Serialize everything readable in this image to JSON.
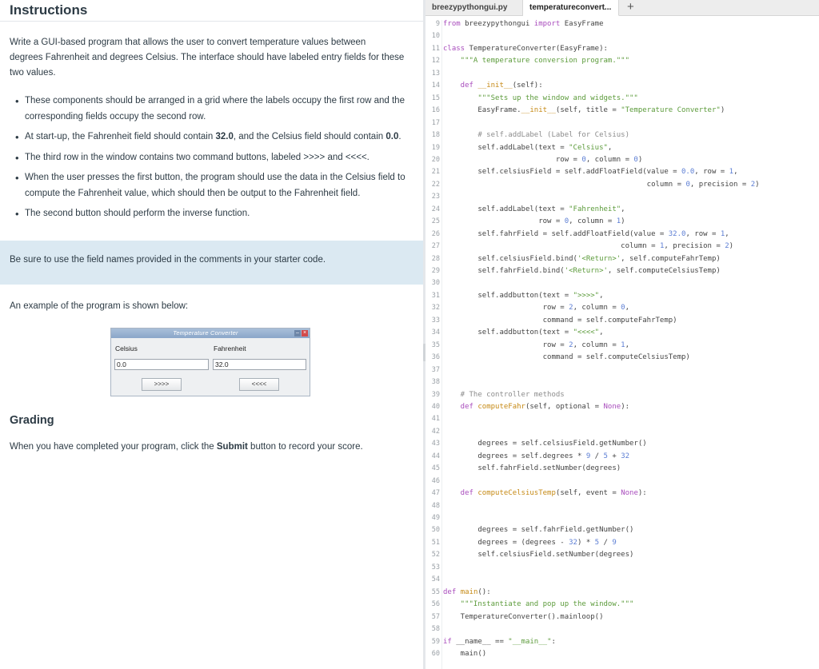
{
  "instructions": {
    "title": "Instructions",
    "intro": [
      "Write a GUI-based program that allows the user to convert temperature values between",
      "degrees Fahrenheit and degrees Celsius. The interface should have labeled entry fields for these",
      "two values."
    ],
    "bullets": [
      [
        {
          "t": "These components should be arranged in a grid where the labels occupy the first row and the corresponding fields occupy the second row."
        }
      ],
      [
        {
          "t": "At start-up, the Fahrenheit field should contain "
        },
        {
          "t": "32.0",
          "b": true
        },
        {
          "t": ", and the Celsius field should contain "
        },
        {
          "t": "0.0",
          "b": true
        },
        {
          "t": "."
        }
      ],
      [
        {
          "t": "The third row in the window contains two command buttons, labeled >>>> and <<<<."
        }
      ],
      [
        {
          "t": "When the user presses the first button, the program should use the data in the Celsius field to compute the Fahrenheit value, which should then be output to the Fahrenheit field."
        }
      ],
      [
        {
          "t": "The second button should perform the inverse function."
        }
      ]
    ],
    "note": "Be sure to use the field names provided in the comments in your starter code.",
    "example_text": "An example of the program is shown below:",
    "grading_title": "Grading",
    "grading_text": [
      {
        "t": "When you have completed your program, click the "
      },
      {
        "t": "Submit",
        "b": true
      },
      {
        "t": " button to record your score."
      }
    ]
  },
  "example_window": {
    "title": "Temperature Converter",
    "celsius_label": "Celsius",
    "fahrenheit_label": "Fahrenheit",
    "celsius_value": "0.0",
    "fahrenheit_value": "32.0",
    "btn_to_fahr": ">>>>",
    "btn_to_cels": "<<<<"
  },
  "editor": {
    "tabs": [
      {
        "label": "breezypythongui.py",
        "active": false
      },
      {
        "label": "temperatureconvert...",
        "active": true
      }
    ],
    "add_tab": "+",
    "lines": [
      {
        "n": "9",
        "s": [
          [
            "from ",
            "k"
          ],
          [
            "breezypythongui ",
            "n"
          ],
          [
            "import ",
            "k"
          ],
          [
            "EasyFrame",
            "n"
          ]
        ]
      },
      {
        "n": "10",
        "s": []
      },
      {
        "n": "11",
        "s": [
          [
            "class ",
            "k"
          ],
          [
            "TemperatureConverter",
            "n"
          ],
          [
            "(EasyFrame):",
            "n"
          ]
        ]
      },
      {
        "n": "12",
        "s": [
          [
            "    \"\"\"A temperature conversion program.\"\"\"",
            "st"
          ]
        ]
      },
      {
        "n": "13",
        "s": []
      },
      {
        "n": "14",
        "s": [
          [
            "    def ",
            "k"
          ],
          [
            "__init__",
            "fn"
          ],
          [
            "(self):",
            "n"
          ]
        ]
      },
      {
        "n": "15",
        "s": [
          [
            "        \"\"\"Sets up the window and widgets.\"\"\"",
            "st"
          ]
        ]
      },
      {
        "n": "16",
        "s": [
          [
            "        EasyFrame.",
            "n"
          ],
          [
            "__init__",
            "fn"
          ],
          [
            "(self, title = ",
            "n"
          ],
          [
            "\"Temperature Converter\"",
            "st"
          ],
          [
            ")",
            "n"
          ]
        ]
      },
      {
        "n": "17",
        "s": []
      },
      {
        "n": "18",
        "s": [
          [
            "        # self.addLabel (Label for Celsius)",
            "cm"
          ]
        ]
      },
      {
        "n": "19",
        "s": [
          [
            "        self.addLabel(text = ",
            "n"
          ],
          [
            "\"Celsius\"",
            "st"
          ],
          [
            ",",
            "n"
          ]
        ]
      },
      {
        "n": "20",
        "s": [
          [
            "                          row = ",
            "n"
          ],
          [
            "0",
            "num"
          ],
          [
            ", column = ",
            "n"
          ],
          [
            "0",
            "num"
          ],
          [
            ")",
            "n"
          ]
        ]
      },
      {
        "n": "21",
        "s": [
          [
            "        self.celsiusField = self.addFloatField(value = ",
            "n"
          ],
          [
            "0.0",
            "num"
          ],
          [
            ", row = ",
            "n"
          ],
          [
            "1",
            "num"
          ],
          [
            ",",
            "n"
          ]
        ]
      },
      {
        "n": "22",
        "s": [
          [
            "                                               column = ",
            "n"
          ],
          [
            "0",
            "num"
          ],
          [
            ", precision = ",
            "n"
          ],
          [
            "2",
            "num"
          ],
          [
            ")",
            "n"
          ]
        ]
      },
      {
        "n": "23",
        "s": []
      },
      {
        "n": "24",
        "s": [
          [
            "        self.addLabel(text = ",
            "n"
          ],
          [
            "\"Fahrenheit\"",
            "st"
          ],
          [
            ",",
            "n"
          ]
        ]
      },
      {
        "n": "25",
        "s": [
          [
            "                      row = ",
            "n"
          ],
          [
            "0",
            "num"
          ],
          [
            ", column = ",
            "n"
          ],
          [
            "1",
            "num"
          ],
          [
            ")",
            "n"
          ]
        ]
      },
      {
        "n": "26",
        "s": [
          [
            "        self.fahrField = self.addFloatField(value = ",
            "n"
          ],
          [
            "32.0",
            "num"
          ],
          [
            ", row = ",
            "n"
          ],
          [
            "1",
            "num"
          ],
          [
            ",",
            "n"
          ]
        ]
      },
      {
        "n": "27",
        "s": [
          [
            "                                         column = ",
            "n"
          ],
          [
            "1",
            "num"
          ],
          [
            ", precision = ",
            "n"
          ],
          [
            "2",
            "num"
          ],
          [
            ")",
            "n"
          ]
        ]
      },
      {
        "n": "28",
        "s": [
          [
            "        self.celsiusField.bind(",
            "n"
          ],
          [
            "'<Return>'",
            "st"
          ],
          [
            ", self.computeFahrTemp)",
            "n"
          ]
        ]
      },
      {
        "n": "29",
        "s": [
          [
            "        self.fahrField.bind(",
            "n"
          ],
          [
            "'<Return>'",
            "st"
          ],
          [
            ", self.computeCelsiusTemp)",
            "n"
          ]
        ]
      },
      {
        "n": "30",
        "s": []
      },
      {
        "n": "31",
        "s": [
          [
            "        self.addbutton(text = ",
            "n"
          ],
          [
            "\">>>>\"",
            "st"
          ],
          [
            ",",
            "n"
          ]
        ]
      },
      {
        "n": "32",
        "s": [
          [
            "                       row = ",
            "n"
          ],
          [
            "2",
            "num"
          ],
          [
            ", column = ",
            "n"
          ],
          [
            "0",
            "num"
          ],
          [
            ",",
            "n"
          ]
        ]
      },
      {
        "n": "33",
        "s": [
          [
            "                       command = self.computeFahrTemp)",
            "n"
          ]
        ]
      },
      {
        "n": "34",
        "s": [
          [
            "        self.addbutton(text = ",
            "n"
          ],
          [
            "\"<<<<\"",
            "st"
          ],
          [
            ",",
            "n"
          ]
        ]
      },
      {
        "n": "35",
        "s": [
          [
            "                       row = ",
            "n"
          ],
          [
            "2",
            "num"
          ],
          [
            ", column = ",
            "n"
          ],
          [
            "1",
            "num"
          ],
          [
            ",",
            "n"
          ]
        ]
      },
      {
        "n": "36",
        "s": [
          [
            "                       command = self.computeCelsiusTemp)",
            "n"
          ]
        ]
      },
      {
        "n": "37",
        "s": []
      },
      {
        "n": "38",
        "s": []
      },
      {
        "n": "39",
        "s": [
          [
            "    # The controller methods",
            "cm"
          ]
        ]
      },
      {
        "n": "40",
        "s": [
          [
            "    def ",
            "k"
          ],
          [
            "computeFahr",
            "fn"
          ],
          [
            "(self, optional = ",
            "n"
          ],
          [
            "None",
            "k"
          ],
          [
            "):",
            "n"
          ]
        ]
      },
      {
        "n": "41",
        "s": []
      },
      {
        "n": "42",
        "s": []
      },
      {
        "n": "43",
        "s": [
          [
            "        degrees = self.celsiusField.getNumber()",
            "n"
          ]
        ]
      },
      {
        "n": "44",
        "s": [
          [
            "        degrees = self.degrees * ",
            "n"
          ],
          [
            "9",
            "num"
          ],
          [
            " / ",
            "n"
          ],
          [
            "5",
            "num"
          ],
          [
            " + ",
            "n"
          ],
          [
            "32",
            "num"
          ]
        ]
      },
      {
        "n": "45",
        "s": [
          [
            "        self.fahrField.setNumber(degrees)",
            "n"
          ]
        ]
      },
      {
        "n": "46",
        "s": []
      },
      {
        "n": "47",
        "s": [
          [
            "    def ",
            "k"
          ],
          [
            "computeCelsiusTemp",
            "fn"
          ],
          [
            "(self, event = ",
            "n"
          ],
          [
            "None",
            "k"
          ],
          [
            "):",
            "n"
          ]
        ]
      },
      {
        "n": "48",
        "s": []
      },
      {
        "n": "49",
        "s": []
      },
      {
        "n": "50",
        "s": [
          [
            "        degrees = self.fahrField.getNumber()",
            "n"
          ]
        ]
      },
      {
        "n": "51",
        "s": [
          [
            "        degrees = (degrees - ",
            "n"
          ],
          [
            "32",
            "num"
          ],
          [
            ") * ",
            "n"
          ],
          [
            "5",
            "num"
          ],
          [
            " / ",
            "n"
          ],
          [
            "9",
            "num"
          ]
        ]
      },
      {
        "n": "52",
        "s": [
          [
            "        self.celsiusField.setNumber(degrees)",
            "n"
          ]
        ]
      },
      {
        "n": "53",
        "s": []
      },
      {
        "n": "54",
        "s": []
      },
      {
        "n": "55",
        "s": [
          [
            "def ",
            "k"
          ],
          [
            "main",
            "fn"
          ],
          [
            "():",
            "n"
          ]
        ]
      },
      {
        "n": "56",
        "s": [
          [
            "    \"\"\"Instantiate and pop up the window.\"\"\"",
            "st"
          ]
        ]
      },
      {
        "n": "57",
        "s": [
          [
            "    TemperatureConverter().mainloop()",
            "n"
          ]
        ]
      },
      {
        "n": "58",
        "s": []
      },
      {
        "n": "59",
        "s": [
          [
            "if ",
            "k"
          ],
          [
            "__name__ == ",
            "n"
          ],
          [
            "\"__main__\"",
            "st"
          ],
          [
            ":",
            "n"
          ]
        ]
      },
      {
        "n": "60",
        "s": [
          [
            "    main()",
            "n"
          ]
        ]
      }
    ]
  },
  "colors": {
    "keyword": "#a94dbd",
    "function": "#c68a16",
    "string": "#5c9b3b",
    "number": "#5c7ed4",
    "comment": "#8c8c8c",
    "plain": "#444444",
    "note_bg": "#dbe9f2"
  }
}
